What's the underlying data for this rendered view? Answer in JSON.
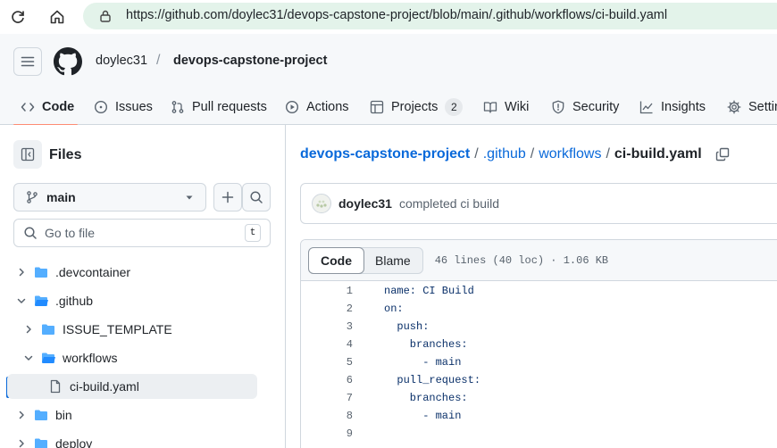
{
  "browser": {
    "url": "https://github.com/doylec31/devops-capstone-project/blob/main/.github/workflows/ci-build.yaml"
  },
  "header": {
    "owner": "doylec31",
    "separator": "/",
    "repo": "devops-capstone-project"
  },
  "tabs": [
    {
      "label": "Code",
      "icon": "code-icon",
      "active": true
    },
    {
      "label": "Issues",
      "icon": "issue-icon"
    },
    {
      "label": "Pull requests",
      "icon": "pull-request-icon"
    },
    {
      "label": "Actions",
      "icon": "play-icon"
    },
    {
      "label": "Projects",
      "icon": "table-icon",
      "count": "2"
    },
    {
      "label": "Wiki",
      "icon": "book-icon"
    },
    {
      "label": "Security",
      "icon": "shield-icon"
    },
    {
      "label": "Insights",
      "icon": "graph-icon"
    },
    {
      "label": "Settings",
      "icon": "gear-icon"
    }
  ],
  "sidebar": {
    "title": "Files",
    "branch": "main",
    "search_placeholder": "Go to file",
    "shortcut": "t",
    "tree": [
      {
        "label": ".devcontainer",
        "type": "folder",
        "depth": 0,
        "expanded": false
      },
      {
        "label": ".github",
        "type": "folder",
        "depth": 0,
        "expanded": true
      },
      {
        "label": "ISSUE_TEMPLATE",
        "type": "folder",
        "depth": 1,
        "expanded": false
      },
      {
        "label": "workflows",
        "type": "folder",
        "depth": 1,
        "expanded": true
      },
      {
        "label": "ci-build.yaml",
        "type": "file",
        "depth": 2,
        "selected": true
      },
      {
        "label": "bin",
        "type": "folder",
        "depth": 0,
        "expanded": false
      },
      {
        "label": "deploy",
        "type": "folder",
        "depth": 0,
        "expanded": false
      }
    ]
  },
  "main": {
    "breadcrumb": {
      "repo": "devops-capstone-project",
      "sep": "/",
      "parts": [
        ".github",
        "workflows"
      ],
      "current": "ci-build.yaml"
    },
    "commit": {
      "author": "doylec31",
      "message": "completed ci build"
    },
    "file": {
      "view_code": "Code",
      "view_blame": "Blame",
      "info": "46 lines (40 loc) · 1.06 KB",
      "lines": [
        {
          "n": "1",
          "text": "name: CI Build"
        },
        {
          "n": "2",
          "text": "on:"
        },
        {
          "n": "3",
          "text": "  push:"
        },
        {
          "n": "4",
          "text": "    branches:"
        },
        {
          "n": "5",
          "text": "      - main"
        },
        {
          "n": "6",
          "text": "  pull_request:"
        },
        {
          "n": "7",
          "text": "    branches:"
        },
        {
          "n": "8",
          "text": "      - main"
        },
        {
          "n": "9",
          "text": ""
        }
      ]
    }
  }
}
